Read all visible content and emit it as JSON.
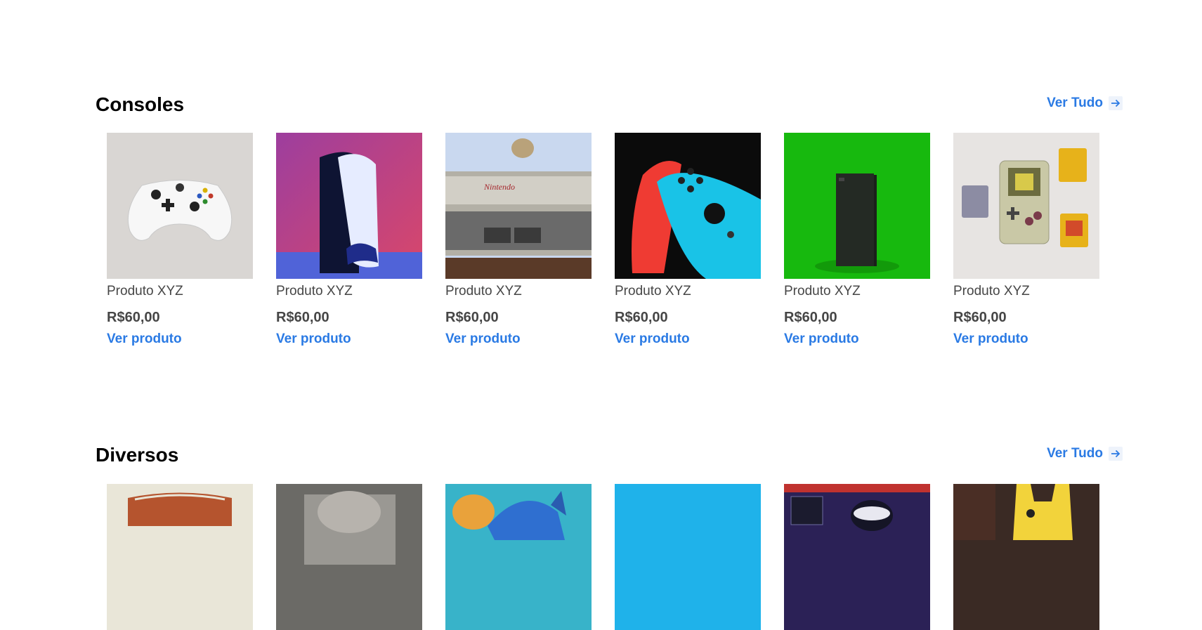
{
  "sections": [
    {
      "title": "Consoles",
      "view_all": "Ver Tudo",
      "products": [
        {
          "name": "Produto XYZ",
          "price": "R$60,00",
          "link": "Ver produto",
          "image": "white-controller"
        },
        {
          "name": "Produto XYZ",
          "price": "R$60,00",
          "link": "Ver produto",
          "image": "ps5-console"
        },
        {
          "name": "Produto XYZ",
          "price": "R$60,00",
          "link": "Ver produto",
          "image": "nes-console"
        },
        {
          "name": "Produto XYZ",
          "price": "R$60,00",
          "link": "Ver produto",
          "image": "switch-joycons"
        },
        {
          "name": "Produto XYZ",
          "price": "R$60,00",
          "link": "Ver produto",
          "image": "xbox-series-x"
        },
        {
          "name": "Produto XYZ",
          "price": "R$60,00",
          "link": "Ver produto",
          "image": "gameboy-cartridges"
        }
      ]
    },
    {
      "title": "Diversos",
      "view_all": "Ver Tudo",
      "products": [
        {
          "image": "misc-1"
        },
        {
          "image": "misc-2"
        },
        {
          "image": "misc-3"
        },
        {
          "image": "misc-4"
        },
        {
          "image": "misc-5"
        },
        {
          "image": "misc-6"
        }
      ]
    }
  ],
  "colors": {
    "accent": "#2A7AE4",
    "text": "#464646",
    "title": "#000000"
  }
}
